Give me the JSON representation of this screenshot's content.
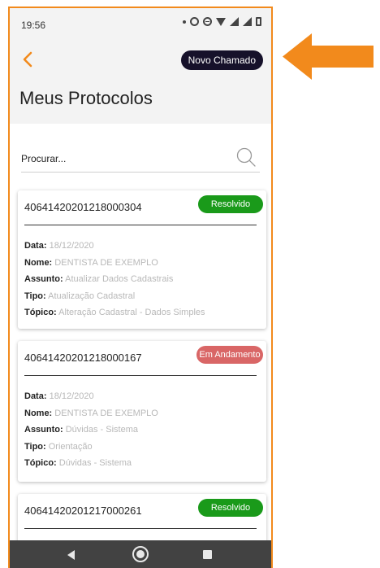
{
  "status": {
    "time": "19:56"
  },
  "header": {
    "new_call_label": "Novo Chamado",
    "title": "Meus Protocolos"
  },
  "search": {
    "placeholder": "Procurar..."
  },
  "labels": {
    "date": "Data:",
    "name": "Nome:",
    "subject": "Assunto:",
    "type": "Tipo:",
    "topic": "Tópico:"
  },
  "protocols": [
    {
      "number": "40641420201218000304",
      "status": "Resolvido",
      "date": "18/12/2020",
      "name": "DENTISTA DE EXEMPLO",
      "subject": "Atualizar Dados Cadastrais",
      "type": "Atualização Cadastral",
      "topic": "Alteração Cadastral - Dados Simples"
    },
    {
      "number": "40641420201218000167",
      "status": "Em Andamento",
      "date": "18/12/2020",
      "name": "DENTISTA DE EXEMPLO",
      "subject": "Dúvidas - Sistema",
      "type": "Orientação",
      "topic": "Dúvidas - Sistema"
    },
    {
      "number": "40641420201217000261",
      "status": "Resolvido"
    }
  ],
  "colors": {
    "accent": "#f28a1c",
    "resolved": "#1a9a1a",
    "in_progress": "#d96666",
    "button_dark": "#16112a"
  },
  "icons": {
    "back": "chevron-left-icon",
    "search": "search-icon",
    "pointer": "arrow-left-icon"
  }
}
